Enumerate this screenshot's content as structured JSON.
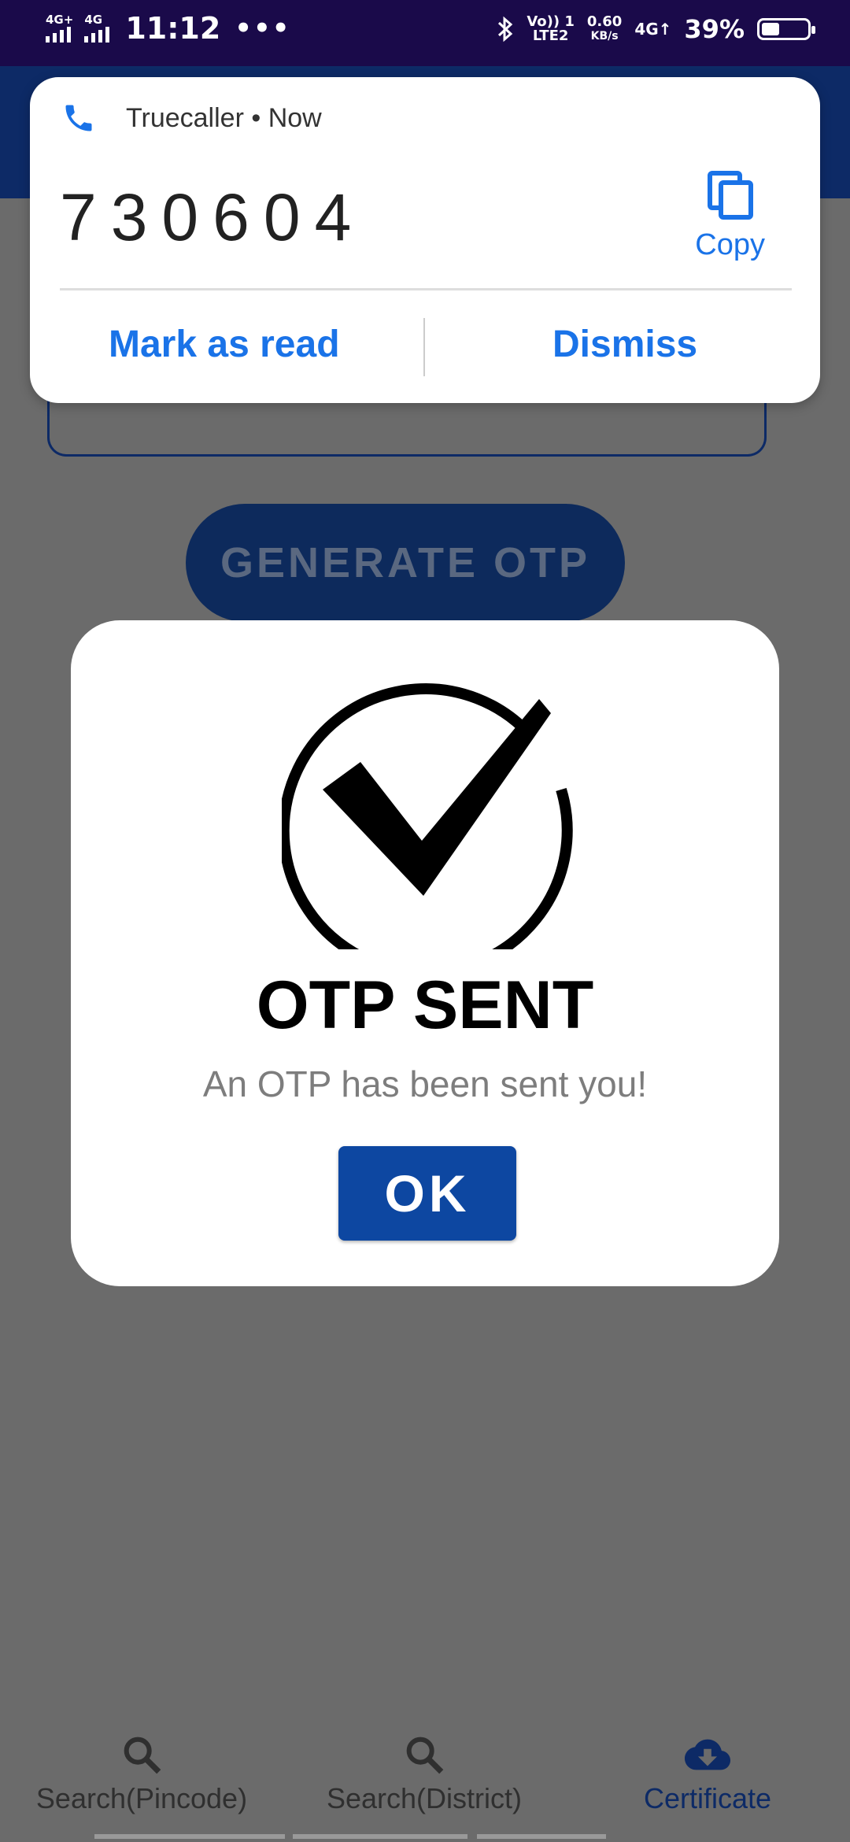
{
  "status_bar": {
    "sim1": "4G+",
    "sim2": "4G",
    "time": "11:12",
    "more": "•••",
    "volte_top": "Vo)) 1",
    "volte_bottom": "LTE2",
    "speed_value": "0.60",
    "speed_unit": "KB/s",
    "net": "4G↑",
    "battery_percent": "39%",
    "battery_level": 0.39
  },
  "background": {
    "generate_button_label": "GENERATE OTP"
  },
  "notification": {
    "app_name": "Truecaller • Now",
    "code": "730604",
    "copy_label": "Copy",
    "mark_as_read_label": "Mark as read",
    "dismiss_label": "Dismiss",
    "accent_color": "#1a73e8"
  },
  "dialog": {
    "title": "OTP SENT",
    "message": "An OTP has been sent you!",
    "ok_label": "OK",
    "ok_color": "#0d47a1"
  },
  "bottom_nav": {
    "items": [
      {
        "label": "Search(Pincode)",
        "icon": "search-icon"
      },
      {
        "label": "Search(District)",
        "icon": "search-icon"
      },
      {
        "label": "Certificate",
        "icon": "cloud-download-icon",
        "active": true
      }
    ]
  }
}
